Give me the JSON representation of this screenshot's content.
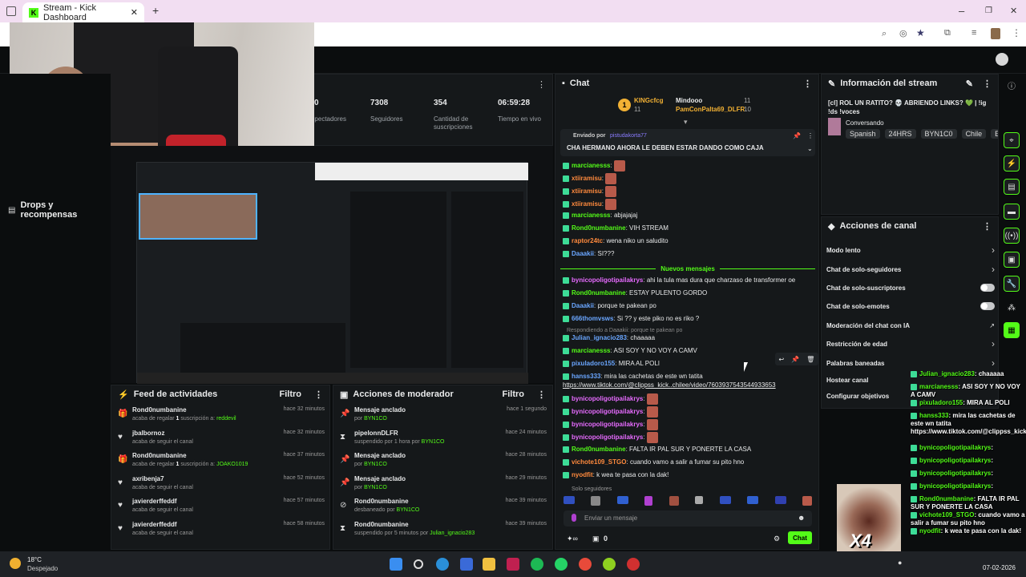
{
  "browser": {
    "tab_title": "Stream - Kick Dashboard",
    "new_tab": "+",
    "controls": [
      "–",
      "❐",
      "✕"
    ]
  },
  "sidebar": {
    "drops_label": "Drops y recompensas"
  },
  "stats": [
    {
      "value": "0",
      "label": "Espectadores"
    },
    {
      "value": "7308",
      "label": "Seguidores"
    },
    {
      "value": "354",
      "label": "Cantidad de suscripciones"
    },
    {
      "value": "06:59:28",
      "label": "Tiempo en vivo"
    }
  ],
  "activity": {
    "title": "Feed de actividades",
    "filter": "Filtro",
    "items": [
      {
        "user": "Rond0numbanine",
        "desc": "acaba de regalar ",
        "extra": "1",
        "desc2": " suscripción a: ",
        "target": "reddevil",
        "time": "hace 32 minutos",
        "icon": "gift-icon"
      },
      {
        "user": "jbalbornoz",
        "desc": "acaba de seguir el canal",
        "extra": "",
        "desc2": "",
        "target": "",
        "time": "hace 32 minutos",
        "icon": "heart-icon"
      },
      {
        "user": "Rond0numbanine",
        "desc": "acaba de regalar ",
        "extra": "1",
        "desc2": " suscripción a: ",
        "target": "JOAKO1019",
        "time": "hace 37 minutos",
        "icon": "gift-icon"
      },
      {
        "user": "axribenja7",
        "desc": "acaba de seguir el canal",
        "extra": "",
        "desc2": "",
        "target": "",
        "time": "hace 52 minutos",
        "icon": "heart-icon"
      },
      {
        "user": "javierderffeddf",
        "desc": "acaba de seguir el canal",
        "extra": "",
        "desc2": "",
        "target": "",
        "time": "hace 57 minutos",
        "icon": "heart-icon"
      },
      {
        "user": "javierderffeddf",
        "desc": "acaba de seguir el canal",
        "extra": "",
        "desc2": "",
        "target": "",
        "time": "hace 58 minutos",
        "icon": "heart-icon"
      }
    ]
  },
  "moderator": {
    "title": "Acciones de moderador",
    "filter": "Filtro",
    "items": [
      {
        "action": "Mensaje anclado",
        "by": "por ",
        "mod": "BYN1CO",
        "time": "hace 1 segundo",
        "icon": "pin-icon"
      },
      {
        "action": "pipelonnDLFR",
        "by": "suspendido por 1 hora por ",
        "mod": "BYN1CO",
        "time": "hace 24 minutos",
        "icon": "hourglass-icon"
      },
      {
        "action": "Mensaje anclado",
        "by": "por ",
        "mod": "BYN1CO",
        "time": "hace 28 minutos",
        "icon": "pin-icon"
      },
      {
        "action": "Mensaje anclado",
        "by": "por ",
        "mod": "BYN1CO",
        "time": "hace 29 minutos",
        "icon": "pin-icon"
      },
      {
        "action": "Rond0numbanine",
        "by": "desbaneado por ",
        "mod": "BYN1CO",
        "time": "hace 39 minutos",
        "icon": "unban-icon"
      },
      {
        "action": "Rond0numbanine",
        "by": "suspendido por 5 minutos por ",
        "mod": "Julian_ignacio283",
        "time": "hace 39 minutos",
        "icon": "hourglass-icon"
      }
    ]
  },
  "chat": {
    "title": "Chat",
    "leaders": [
      {
        "name": "KINGcfcg",
        "count": "11",
        "rank": "1"
      },
      {
        "name": "Mindooo",
        "count": "11",
        "rank": ""
      },
      {
        "name": "PamConPalta69_DLFR",
        "count": "10",
        "rank": ""
      }
    ],
    "pinned_by_label": "Enviado por",
    "pinned_by": "pistudakorta77",
    "pinned_msg": "CHA HERMANO AHORA LE DEBEN ESTAR DANDO COMO CAJA",
    "new_messages": "Nuevos mensajes",
    "replying": "Respondiendo a Daaakii: porque te pakean po",
    "only_followers": "Solo seguidores",
    "send_placeholder": "Enviar un mensaje",
    "send_button": "Chat",
    "points": "0",
    "messages": [
      {
        "user": "marcianesss",
        "text": "",
        "cls": "u2",
        "emote": true
      },
      {
        "user": "xtiiramisu",
        "text": "",
        "cls": "u4",
        "emote": true
      },
      {
        "user": "xtiiramisu",
        "text": "",
        "cls": "u4",
        "emote": true
      },
      {
        "user": "xtiiramisu",
        "text": "",
        "cls": "u4",
        "emote": true
      },
      {
        "user": "marcianesss",
        "text": "abjajajaj",
        "cls": "u2",
        "emote": false
      },
      {
        "user": "Rond0numbanine",
        "text": "VIH STREAM",
        "cls": "u2",
        "emote": false
      },
      {
        "user": "raptor24tc",
        "text": "wena niko un saludito",
        "cls": "u4",
        "emote": false
      },
      {
        "user": "Daaakii",
        "text": "SI???",
        "cls": "u3",
        "emote": false
      },
      {
        "user": "bynicopoligotipailakrys",
        "text": "ahi la tula mas dura que charzaso de transformer oe",
        "cls": "u1",
        "emote": false
      },
      {
        "user": "Rond0numbanine",
        "text": "ESTAY PULENTO GORDO",
        "cls": "u2",
        "emote": false
      },
      {
        "user": "Daaakii",
        "text": "porque te pakean po",
        "cls": "u3",
        "emote": false
      },
      {
        "user": "666thomvsws",
        "text": "Si ?? y este piko no es riko ?",
        "cls": "u3",
        "emote": false
      },
      {
        "user": "Julian_ignacio283",
        "text": "chaaaaa",
        "cls": "u3",
        "emote": false
      },
      {
        "user": "marcianesss",
        "text": "ASI SOY Y NO VOY A CAMV",
        "cls": "u2",
        "emote": false
      },
      {
        "user": "pixuladoro155",
        "text": "MIRA AL POLI",
        "cls": "u3",
        "emote": false
      },
      {
        "user": "hanss333",
        "text": "mira las cachetas de este wn tatita",
        "cls": "u3",
        "emote": false
      },
      {
        "user": "",
        "text": "https://www.tiktok.com/@clippss_kick..chilee/video/7603937543544933653",
        "cls": "",
        "emote": false
      },
      {
        "user": "bynicopoligotipailakrys",
        "text": "",
        "cls": "u1",
        "emote": true
      },
      {
        "user": "bynicopoligotipailakrys",
        "text": "",
        "cls": "u1",
        "emote": true
      },
      {
        "user": "bynicopoligotipailakrys",
        "text": "",
        "cls": "u1",
        "emote": true
      },
      {
        "user": "bynicopoligotipailakrys",
        "text": "",
        "cls": "u1",
        "emote": true
      },
      {
        "user": "Rond0numbanine",
        "text": "FALTA IR PAL SUR Y PONERTE LA CASA",
        "cls": "u2",
        "emote": false
      },
      {
        "user": "vichote109_STGO",
        "text": "cuando vamo a salir a fumar su pito hno",
        "cls": "u4",
        "emote": false
      },
      {
        "user": "nyodfit",
        "text": "k wea te pasa con la dak!",
        "cls": "u4",
        "emote": false
      }
    ]
  },
  "stream_info": {
    "title": "Información del stream",
    "stream_title": "[cl] ROL UN RATITO? 💀 ABRIENDO LINKS? 💚 | !ig !ds !voces",
    "category": "Conversando",
    "tags": [
      "Spanish",
      "24HRS",
      "BYN1C0",
      "Chile",
      "Españ"
    ]
  },
  "channel_actions": {
    "title": "Acciones de canal",
    "items": [
      {
        "label": "Modo lento",
        "control": "chevron"
      },
      {
        "label": "Chat de solo-seguidores",
        "control": "chevron"
      },
      {
        "label": "Chat de solo-suscriptores",
        "control": "toggle"
      },
      {
        "label": "Chat de solo-emotes",
        "control": "toggle"
      },
      {
        "label": "Moderación del chat con IA",
        "control": "external"
      },
      {
        "label": "Restricción de edad",
        "control": "chevron"
      },
      {
        "label": "Palabras baneadas",
        "control": "chevron"
      },
      {
        "label": "Hostear canal",
        "control": "none"
      },
      {
        "label": "Configurar objetivos",
        "control": "none"
      }
    ]
  },
  "overlay_chat": [
    {
      "user": "Julian_ignacio283",
      "text": "chaaaaa"
    },
    {
      "user": "marcianesss",
      "text": "ASI SOY Y NO VOY A CAMV"
    },
    {
      "user": "pixuladoro155",
      "text": "MIRA AL POLI"
    },
    {
      "user": "hanss333",
      "text": "mira las cachetas de este wn tatita https://www.tiktok.com/@clippss_kick..chilee/video/7603937543544933653"
    },
    {
      "user": "bynicopoligotipailakrys",
      "text": ""
    },
    {
      "user": "bynicopoligotipailakrys",
      "text": ""
    },
    {
      "user": "bynicopoligotipailakrys",
      "text": ""
    },
    {
      "user": "bynicopoligotipailakrys",
      "text": ""
    },
    {
      "user": "Rond0numbanine",
      "text": "FALTA IR PAL SUR Y PONERTE LA CASA"
    },
    {
      "user": "vichote109_STGO",
      "text": "cuando vamo a salir a fumar su pito hno"
    },
    {
      "user": "nyodfit",
      "text": "k wea te pasa con la dak!"
    }
  ],
  "x4_label": "X4",
  "taskbar": {
    "weather_temp": "18°C",
    "weather_desc": "Despejado",
    "date": "07-02-2026"
  },
  "colors": {
    "accent": "#53fc18",
    "panel": "#15181a",
    "bg": "#0b0d0e"
  }
}
